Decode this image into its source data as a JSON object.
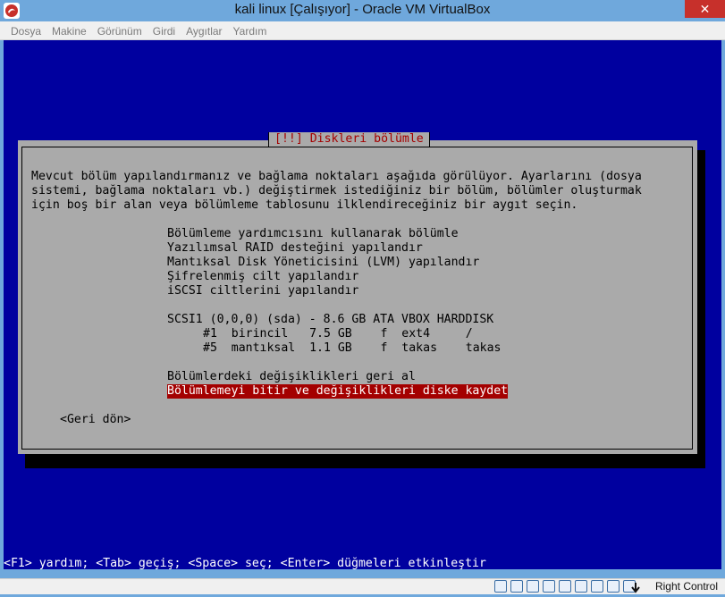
{
  "window": {
    "title": "kali linux [Çalışıyor] - Oracle VM VirtualBox",
    "close_glyph": "✕"
  },
  "menu": [
    "Dosya",
    "Makine",
    "Görünüm",
    "Girdi",
    "Aygıtlar",
    "Yardım"
  ],
  "dialog": {
    "title": "[!!] Diskleri bölümle",
    "description": [
      "Mevcut bölüm yapılandırmanız ve bağlama noktaları aşağıda görülüyor. Ayarlarını (dosya",
      "sistemi, bağlama noktaları vb.) değiştirmek istediğiniz bir bölüm, bölümler oluşturmak",
      "için boş bir alan veya bölümleme tablosunu ilklendireceğiniz bir aygıt seçin."
    ],
    "options": [
      "Bölümleme yardımcısını kullanarak bölümle",
      "Yazılımsal RAID desteğini yapılandır",
      "Mantıksal Disk Yöneticisini (LVM) yapılandır",
      "Şifrelenmiş cilt yapılandır",
      "iSCSI ciltlerini yapılandır"
    ],
    "disk": {
      "label": "SCSI1 (0,0,0) (sda) - 8.6 GB ATA VBOX HARDDISK",
      "partitions": [
        "#1  birincil   7.5 GB    f  ext4     /",
        "#5  mantıksal  1.1 GB    f  takas    takas"
      ]
    },
    "actions": [
      "Bölümlerdeki değişiklikleri geri al",
      "Bölümlemeyi bitir ve değişiklikleri diske kaydet"
    ],
    "selected_action": 1,
    "back_button": "<Geri dön>"
  },
  "status_line": "<F1> yardım; <Tab> geçiş; <Space> seç; <Enter> düğmeleri etkinleştir",
  "host_key": "Right Control",
  "colors": {
    "screen_bg": "#00009f",
    "dialog_bg": "#aaaaaa",
    "title_red": "#a40000",
    "selection_bg": "#a40000"
  }
}
